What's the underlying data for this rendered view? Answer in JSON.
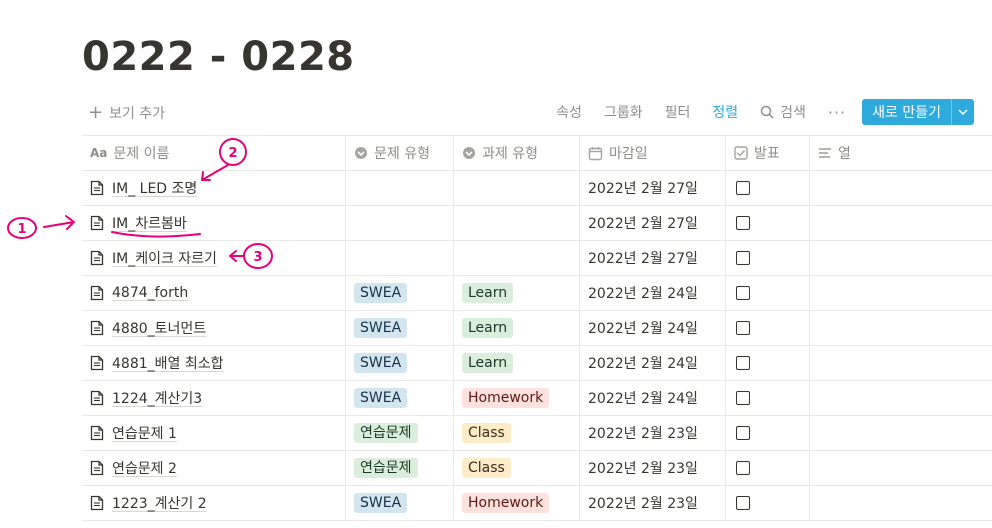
{
  "page": {
    "title": "0222 - 0228"
  },
  "toolbar": {
    "add_view": "보기 추가",
    "properties": "속성",
    "group": "그룹화",
    "filter": "필터",
    "sort": "정렬",
    "search": "검색",
    "more": "···",
    "new_button": "새로 만들기"
  },
  "columns": {
    "name": "문제 이름",
    "problem_type": "문제 유형",
    "task_type": "과제 유형",
    "due_date": "마감일",
    "presentation": "발표",
    "col": "열"
  },
  "rows": [
    {
      "name": "IM_ LED 조명",
      "problem_type": "",
      "task_type": "",
      "due": "2022년 2월 27일"
    },
    {
      "name": "IM_차르봄바",
      "problem_type": "",
      "task_type": "",
      "due": "2022년 2월 27일"
    },
    {
      "name": "IM_케이크 자르기",
      "problem_type": "",
      "task_type": "",
      "due": "2022년 2월 27일"
    },
    {
      "name": "4874_forth",
      "problem_type": "SWEA",
      "task_type": "Learn",
      "due": "2022년 2월 24일"
    },
    {
      "name": "4880_토너먼트",
      "problem_type": "SWEA",
      "task_type": "Learn",
      "due": "2022년 2월 24일"
    },
    {
      "name": "4881_배열 최소합",
      "problem_type": "SWEA",
      "task_type": "Learn",
      "due": "2022년 2월 24일"
    },
    {
      "name": "1224_계산기3",
      "problem_type": "SWEA",
      "task_type": "Homework",
      "due": "2022년 2월 24일"
    },
    {
      "name": "연습문제 1",
      "problem_type": "연습문제",
      "task_type": "Class",
      "due": "2022년 2월 23일"
    },
    {
      "name": "연습문제 2",
      "problem_type": "연습문제",
      "task_type": "Class",
      "due": "2022년 2월 23일"
    },
    {
      "name": "1223_계산기 2",
      "problem_type": "SWEA",
      "task_type": "Homework",
      "due": "2022년 2월 23일"
    }
  ],
  "tag_colors": {
    "SWEA": {
      "bg": "#d3e5ef",
      "fg": "#183347"
    },
    "연습문제": {
      "bg": "#dbeddb",
      "fg": "#1c3829"
    },
    "Learn": {
      "bg": "#dbeddb",
      "fg": "#1c3829"
    },
    "Homework": {
      "bg": "#ffe2dd",
      "fg": "#5d1715"
    },
    "Class": {
      "bg": "#fdecc8",
      "fg": "#402c1b"
    }
  },
  "annotations": {
    "mark1": "1",
    "mark2": "2",
    "mark3": "3",
    "color": "#e8007a"
  },
  "colors": {
    "accent": "#2eaadc"
  }
}
